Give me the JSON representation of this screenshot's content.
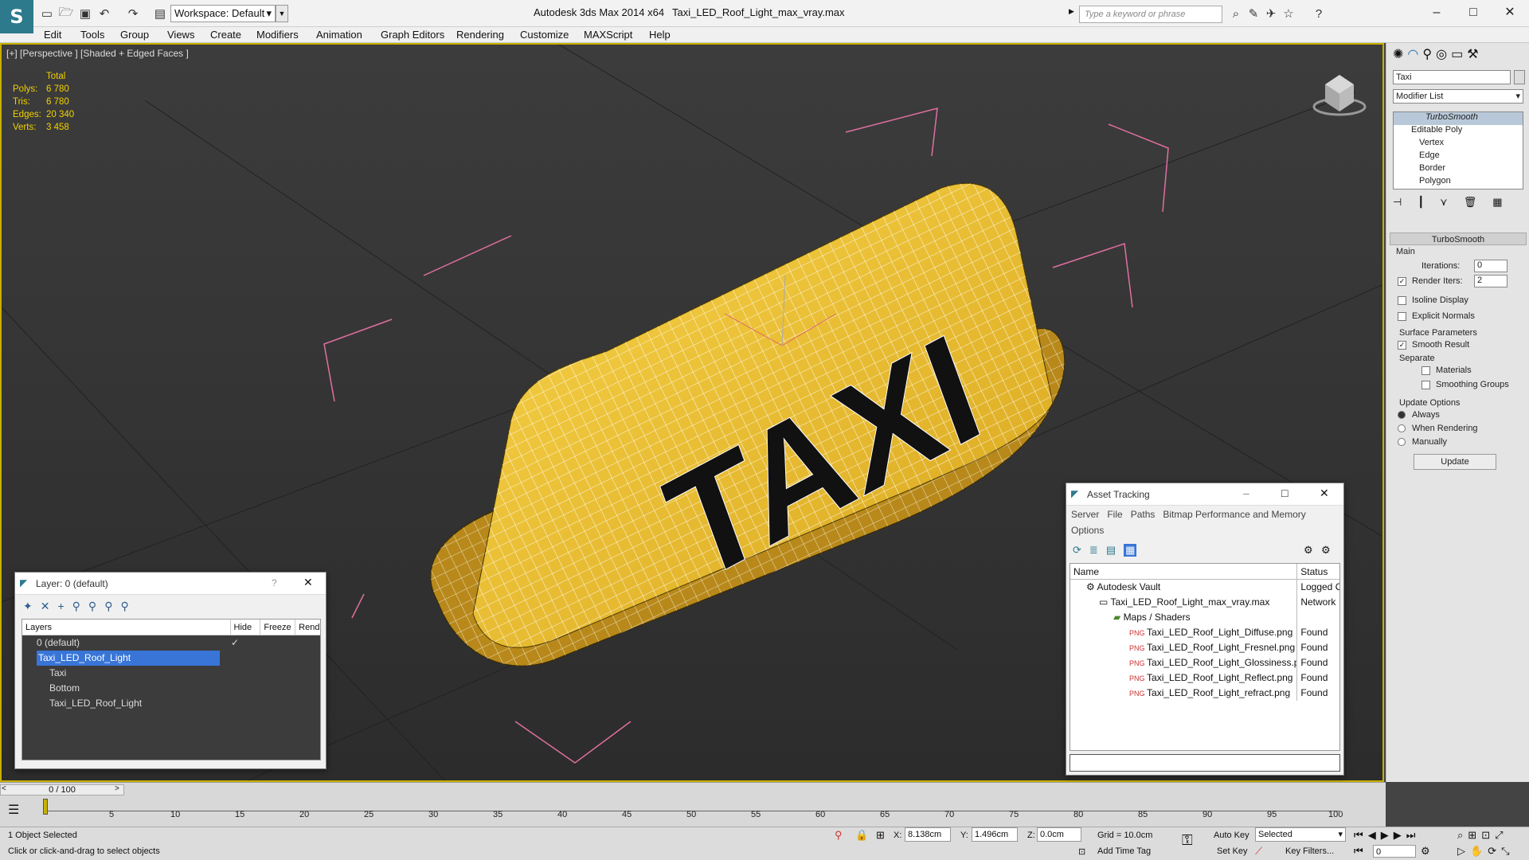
{
  "app": {
    "title": "Autodesk 3ds Max  2014 x64",
    "file": "Taxi_LED_Roof_Light_max_vray.max",
    "workspace": "Workspace: Default",
    "search_placeholder": "Type a keyword or phrase"
  },
  "menu": [
    "Edit",
    "Tools",
    "Group",
    "Views",
    "Create",
    "Modifiers",
    "Animation",
    "Graph Editors",
    "Rendering",
    "Customize",
    "MAXScript",
    "Help"
  ],
  "viewport": {
    "label": "[+] [Perspective ] [Shaded + Edged Faces ]",
    "stats": {
      "header": "Total",
      "rows": [
        {
          "label": "Polys:",
          "value": "6 780"
        },
        {
          "label": "Tris:",
          "value": "6 780"
        },
        {
          "label": "Edges:",
          "value": "20 340"
        },
        {
          "label": "Verts:",
          "value": "3 458"
        }
      ]
    },
    "model_text": "TAXI"
  },
  "command_panel": {
    "object_name": "Taxi",
    "modifier_list": "Modifier List",
    "stack": [
      "TurboSmooth",
      "Editable Poly",
      "Vertex",
      "Edge",
      "Border",
      "Polygon"
    ],
    "rollout": "TurboSmooth",
    "main": "Main",
    "iterations_label": "Iterations:",
    "iterations": "0",
    "render_iters_label": "Render Iters:",
    "render_iters": "2",
    "isoline": "Isoline Display",
    "explicit": "Explicit Normals",
    "surface": "Surface Parameters",
    "smooth": "Smooth Result",
    "separate": "Separate",
    "materials": "Materials",
    "smoothing_groups": "Smoothing Groups",
    "update_options": "Update Options",
    "always": "Always",
    "when_rendering": "When Rendering",
    "manually": "Manually",
    "update_btn": "Update"
  },
  "layer_dialog": {
    "title": "Layer: 0 (default)",
    "help": "?",
    "cols": [
      "Layers",
      "Hide",
      "Freeze",
      "Render"
    ],
    "rows": [
      {
        "name": "0 (default)",
        "indent": 0,
        "selected": false
      },
      {
        "name": "Taxi_LED_Roof_Light",
        "indent": 0,
        "selected": true
      },
      {
        "name": "Taxi",
        "indent": 1,
        "selected": false
      },
      {
        "name": "Bottom",
        "indent": 1,
        "selected": false
      },
      {
        "name": "Taxi_LED_Roof_Light",
        "indent": 1,
        "selected": false
      }
    ]
  },
  "asset_tracking": {
    "title": "Asset Tracking",
    "menu": [
      "Server",
      "File",
      "Paths",
      "Bitmap Performance and Memory",
      "Options"
    ],
    "cols": [
      "Name",
      "Status"
    ],
    "rows": [
      {
        "name": "Autodesk Vault",
        "status": "Logged O",
        "indent": 0
      },
      {
        "name": "Taxi_LED_Roof_Light_max_vray.max",
        "status": "Network",
        "indent": 1
      },
      {
        "name": "Maps / Shaders",
        "status": "",
        "indent": 2
      },
      {
        "name": "Taxi_LED_Roof_Light_Diffuse.png",
        "status": "Found",
        "indent": 3
      },
      {
        "name": "Taxi_LED_Roof_Light_Fresnel.png",
        "status": "Found",
        "indent": 3
      },
      {
        "name": "Taxi_LED_Roof_Light_Glossiness.png",
        "status": "Found",
        "indent": 3
      },
      {
        "name": "Taxi_LED_Roof_Light_Reflect.png",
        "status": "Found",
        "indent": 3
      },
      {
        "name": "Taxi_LED_Roof_Light_refract.png",
        "status": "Found",
        "indent": 3
      }
    ]
  },
  "timeline": {
    "frame": "0 / 100",
    "ticks": [
      "5",
      "10",
      "15",
      "20",
      "25",
      "30",
      "35",
      "40",
      "45",
      "50",
      "55",
      "60",
      "65",
      "70",
      "75",
      "80",
      "85",
      "90",
      "95",
      "100"
    ]
  },
  "status": {
    "selected": "1 Object Selected",
    "hint": "Click or click-and-drag to select objects",
    "x_label": "X:",
    "x": "8.138cm",
    "y_label": "Y:",
    "y": "1.496cm",
    "z_label": "Z:",
    "z": "0.0cm",
    "grid": "Grid = 10.0cm",
    "auto_key": "Auto Key",
    "set_key": "Set Key",
    "key_mode": "Selected",
    "key_filters": "Key Filters...",
    "add_time_tag": "Add Time Tag",
    "frame_field": "0"
  },
  "colors": {
    "accent": "#c8b000",
    "selection": "#3875d7",
    "taxi_yellow": "#f2c42e"
  }
}
